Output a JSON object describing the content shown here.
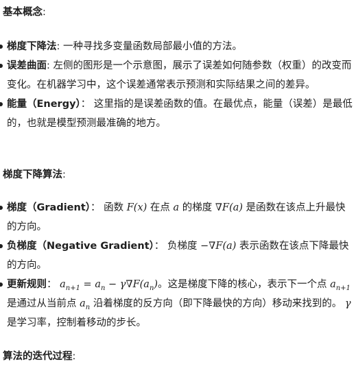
{
  "sections": {
    "basic": {
      "title": "基本概念",
      "colon": ":"
    },
    "algorithm": {
      "title": "梯度下降算法",
      "colon": ":"
    },
    "iteration": {
      "title": "算法的迭代过程",
      "colon": ":"
    }
  },
  "basic_items": [
    {
      "term": "梯度下降法",
      "sep": ":",
      "text": "一种寻找多变量函数局部最小值的方法。"
    },
    {
      "term": "误差曲面",
      "sep": ":",
      "text": "左侧的图形是一个示意图，展示了误差如何随参数（权重）的改变而变化。在机器学习中，这个误差通常表示预测和实际结果之间的差异。"
    },
    {
      "term": "能量（Energy）",
      "sep": "：",
      "text": "这里指的是误差函数的值。在最优点，能量（误差）是最低的，也就是模型预测最准确的地方。"
    }
  ],
  "algo_items": [
    {
      "term": "梯度（Gradient）",
      "sep": "：",
      "t1": "函数",
      "m1": "F(x)",
      "t2": "在点",
      "m2": "a",
      "t3": "的梯度",
      "m3": "∇F(a)",
      "t4": "是函数在该点上升最快的方向。"
    },
    {
      "term": "负梯度（Negative Gradient）",
      "sep": "：",
      "t1": "负梯度",
      "m1": "−∇F(a)",
      "t2": "表示函数在该点下降最快的方向。"
    },
    {
      "term": "更新规则",
      "sep": "：",
      "m1": "a_{n+1} = a_n − γ∇F(a_n)",
      "t1": "。这是梯度下降的核心，表示下一个点",
      "m2": "a_{n+1}",
      "t2": "是通过从当前点",
      "m3": "a_n",
      "t3": "沿着梯度的反方向（即下降最快的方向）移动来找到的。",
      "m4": "γ",
      "t4": "是学习率，控制着移动的步长。"
    }
  ]
}
